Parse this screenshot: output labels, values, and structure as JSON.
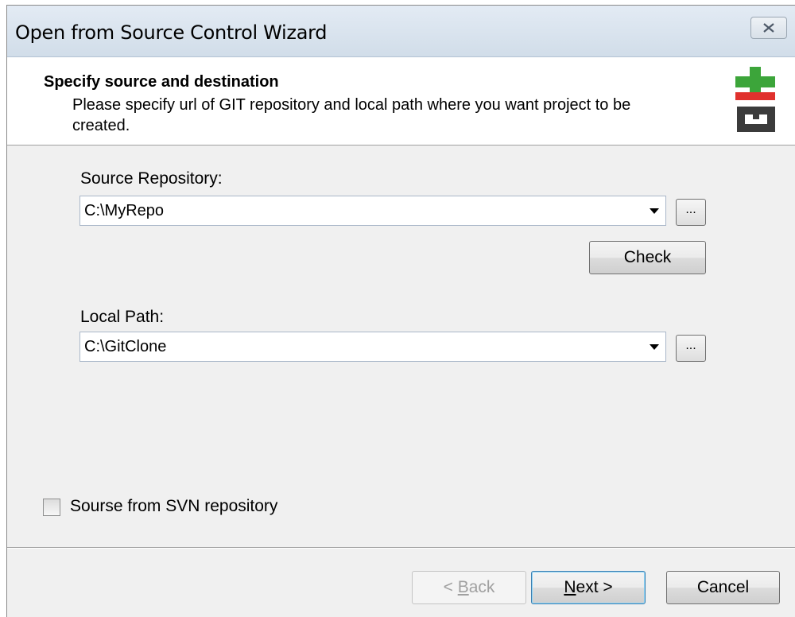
{
  "window": {
    "title": "Open from Source Control Wizard"
  },
  "header": {
    "title": "Specify source and destination",
    "subtitle": "Please specify url of GIT repository and local path where you want project to be created."
  },
  "source": {
    "label": "Source Repository:",
    "value": "C:\\MyRepo",
    "browse_label": "...",
    "check_label": "Check"
  },
  "local": {
    "label": "Local Path:",
    "value": "C:\\GitClone",
    "browse_label": "..."
  },
  "svn_checkbox": {
    "label": "Sourse from SVN repository",
    "checked": false
  },
  "footer": {
    "back_prefix": "< ",
    "back_accel": "B",
    "back_rest": "ack",
    "next_accel": "N",
    "next_rest": "ext >",
    "cancel_label": "Cancel"
  },
  "icons": {
    "close": "close-icon",
    "logo": "git-logo",
    "dropdown": "chevron-down-icon"
  },
  "colors": {
    "logo_green": "#3ca53a",
    "logo_red": "#e0312d",
    "logo_dark": "#3b3b3b"
  }
}
